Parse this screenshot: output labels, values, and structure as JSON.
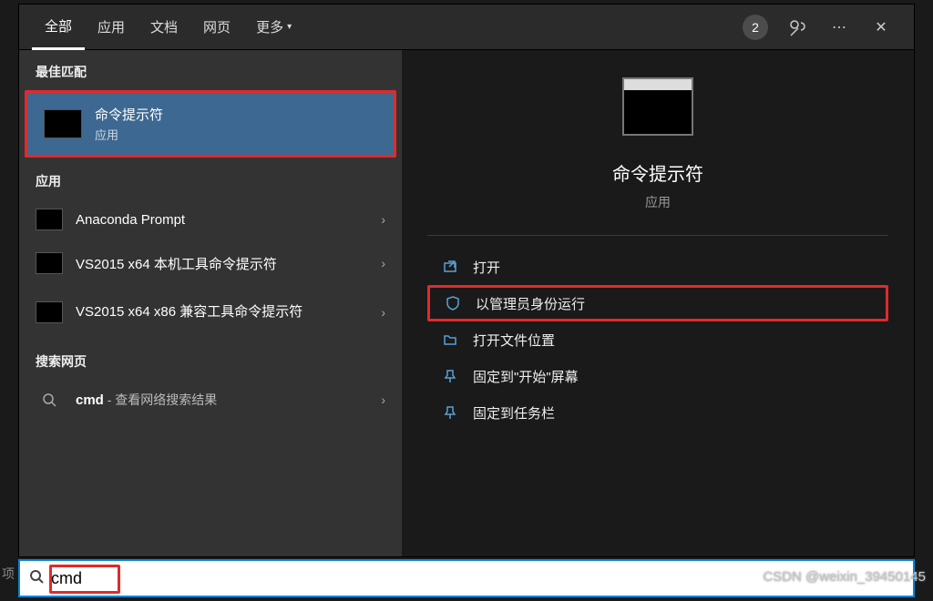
{
  "tabs": {
    "all": "全部",
    "apps": "应用",
    "docs": "文档",
    "web": "网页",
    "more": "更多"
  },
  "header": {
    "badge": "2"
  },
  "sections": {
    "best": "最佳匹配",
    "apps": "应用",
    "web": "搜索网页"
  },
  "best_match": {
    "title": "命令提示符",
    "sub": "应用"
  },
  "app_results": [
    {
      "title": "Anaconda Prompt"
    },
    {
      "title": "VS2015 x64 本机工具命令提示符"
    },
    {
      "title": "VS2015 x64 x86 兼容工具命令提示符"
    }
  ],
  "web_result": {
    "prefix": "cmd",
    "suffix": " - 查看网络搜索结果"
  },
  "preview": {
    "title": "命令提示符",
    "sub": "应用"
  },
  "actions": {
    "open": "打开",
    "admin": "以管理员身份运行",
    "location": "打开文件位置",
    "pin_start": "固定到\"开始\"屏幕",
    "pin_taskbar": "固定到任务栏"
  },
  "search": {
    "value": "cmd"
  },
  "watermark": "CSDN @weixin_39450145"
}
